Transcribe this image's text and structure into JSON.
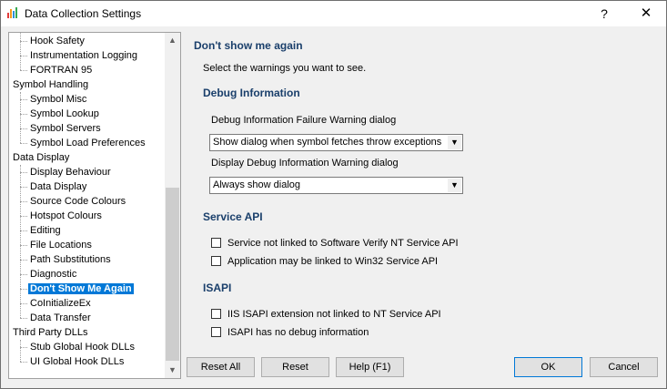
{
  "window": {
    "title": "Data Collection Settings",
    "help_glyph": "?",
    "close_glyph": "✕"
  },
  "tree": {
    "items": [
      {
        "label": "Hook Safety",
        "level": 1
      },
      {
        "label": "Instrumentation Logging",
        "level": 1
      },
      {
        "label": "FORTRAN 95",
        "level": 1
      },
      {
        "label": "Symbol Handling",
        "level": 0
      },
      {
        "label": "Symbol Misc",
        "level": 1
      },
      {
        "label": "Symbol Lookup",
        "level": 1
      },
      {
        "label": "Symbol Servers",
        "level": 1
      },
      {
        "label": "Symbol Load Preferences",
        "level": 1
      },
      {
        "label": "Data Display",
        "level": 0
      },
      {
        "label": "Display Behaviour",
        "level": 1
      },
      {
        "label": "Data Display",
        "level": 1
      },
      {
        "label": "Source Code Colours",
        "level": 1
      },
      {
        "label": "Hotspot Colours",
        "level": 1
      },
      {
        "label": "Editing",
        "level": 1
      },
      {
        "label": "File Locations",
        "level": 1
      },
      {
        "label": "Path Substitutions",
        "level": 1
      },
      {
        "label": "Diagnostic",
        "level": 1
      },
      {
        "label": "Don't Show Me Again",
        "level": 1,
        "selected": true
      },
      {
        "label": "CoInitializeEx",
        "level": 1
      },
      {
        "label": "Data Transfer",
        "level": 1
      },
      {
        "label": "Third Party DLLs",
        "level": 0
      },
      {
        "label": "Stub Global Hook DLLs",
        "level": 1
      },
      {
        "label": "UI Global Hook DLLs",
        "level": 1
      }
    ]
  },
  "panel": {
    "title": "Don't show me again",
    "intro": "Select the warnings you want to see.",
    "debug": {
      "heading": "Debug Information",
      "failure_label": "Debug Information Failure Warning dialog",
      "failure_value": "Show dialog when symbol fetches throw exceptions",
      "display_label": "Display Debug Information Warning dialog",
      "display_value": "Always show dialog"
    },
    "service": {
      "heading": "Service API",
      "check1": "Service not linked to Software Verify NT Service API",
      "check2": "Application may be linked to Win32 Service API"
    },
    "isapi": {
      "heading": "ISAPI",
      "check1": "IIS ISAPI extension not linked to NT Service API",
      "check2": "ISAPI has no debug information"
    }
  },
  "buttons": {
    "reset_all": "Reset All",
    "reset": "Reset",
    "help": "Help (F1)",
    "ok": "OK",
    "cancel": "Cancel"
  },
  "colors": {
    "heading": "#1a3f6b",
    "selection": "#0078d7"
  }
}
